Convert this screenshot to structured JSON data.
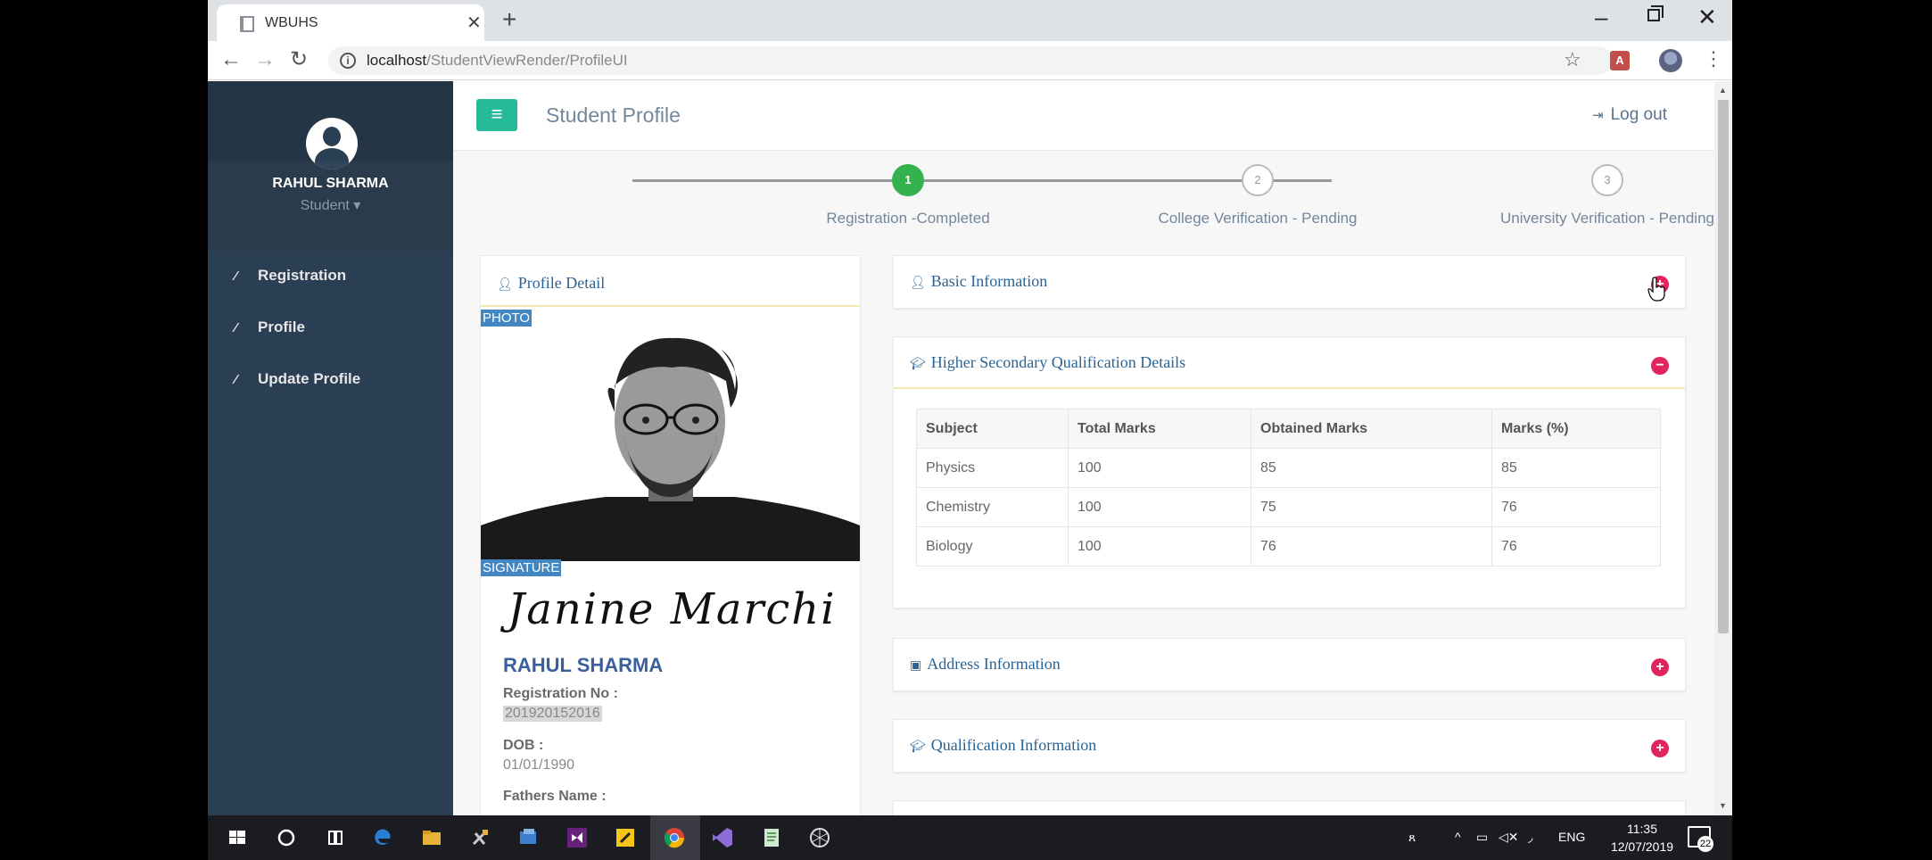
{
  "browser": {
    "tab_title": "WBUHS",
    "url_host": "localhost",
    "url_path": "/StudentViewRender/ProfileUI"
  },
  "sidebar": {
    "user_name": "RAHUL SHARMA",
    "user_role": "Student ▾",
    "items": [
      {
        "label": "Registration"
      },
      {
        "label": "Profile"
      },
      {
        "label": "Update Profile"
      }
    ]
  },
  "header": {
    "title": "Student Profile",
    "logout_label": "Log out"
  },
  "stepper": {
    "steps": [
      {
        "number": "1",
        "label": "Registration -Completed"
      },
      {
        "number": "2",
        "label": "College Verification - Pending"
      },
      {
        "number": "3",
        "label": "University Verification - Pending"
      }
    ]
  },
  "profile_card": {
    "title": "Profile Detail",
    "photo_label": "PHOTO",
    "signature_label": "SIGNATURE",
    "signature_text": "Janine Marchi",
    "name": "RAHUL SHARMA",
    "reg_no_label": "Registration No :",
    "reg_no_value": "201920152016",
    "dob_label": "DOB :",
    "dob_value": "01/01/1990",
    "fathers_name_label": "Fathers Name :"
  },
  "panels": {
    "basic": {
      "title": "Basic Information",
      "toggle": "+"
    },
    "higher_secondary": {
      "title": "Higher Secondary Qualification Details",
      "toggle": "−",
      "columns": [
        "Subject",
        "Total Marks",
        "Obtained Marks",
        "Marks (%)"
      ],
      "rows": [
        [
          "Physics",
          "100",
          "85",
          "85"
        ],
        [
          "Chemistry",
          "100",
          "75",
          "76"
        ],
        [
          "Biology",
          "100",
          "76",
          "76"
        ]
      ]
    },
    "address": {
      "title": "Address Information",
      "toggle": "+"
    },
    "qualification": {
      "title": "Qualification Information",
      "toggle": "+"
    }
  },
  "taskbar": {
    "language": "ENG",
    "time": "11:35",
    "date": "12/07/2019",
    "notification_count": "22"
  }
}
